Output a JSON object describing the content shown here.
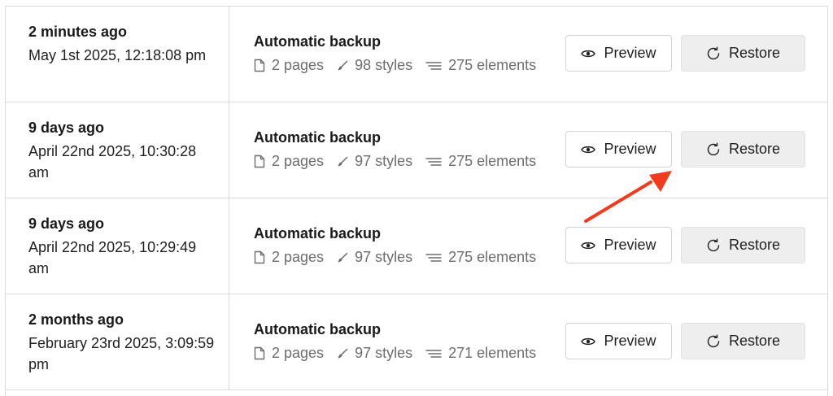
{
  "backups": [
    {
      "relative_time": "2 minutes ago",
      "timestamp": "May 1st 2025, 12:18:08 pm",
      "title": "Automatic backup",
      "pages": "2 pages",
      "styles": "98 styles",
      "elements": "275 elements",
      "preview_label": "Preview",
      "restore_label": "Restore"
    },
    {
      "relative_time": "9 days ago",
      "timestamp": "April 22nd 2025, 10:30:28 am",
      "title": "Automatic backup",
      "pages": "2 pages",
      "styles": "97 styles",
      "elements": "275 elements",
      "preview_label": "Preview",
      "restore_label": "Restore"
    },
    {
      "relative_time": "9 days ago",
      "timestamp": "April 22nd 2025, 10:29:49 am",
      "title": "Automatic backup",
      "pages": "2 pages",
      "styles": "97 styles",
      "elements": "275 elements",
      "preview_label": "Preview",
      "restore_label": "Restore"
    },
    {
      "relative_time": "2 months ago",
      "timestamp": "February 23rd 2025, 3:09:59 pm",
      "title": "Automatic backup",
      "pages": "2 pages",
      "styles": "97 styles",
      "elements": "271 elements",
      "preview_label": "Preview",
      "restore_label": "Restore"
    }
  ],
  "annotation": {
    "arrow_color": "#f23a1d"
  },
  "icons": {
    "pages": "page-icon",
    "styles": "brush-icon",
    "elements": "stack-lines-icon",
    "preview": "eye-icon",
    "restore": "restore-icon"
  }
}
